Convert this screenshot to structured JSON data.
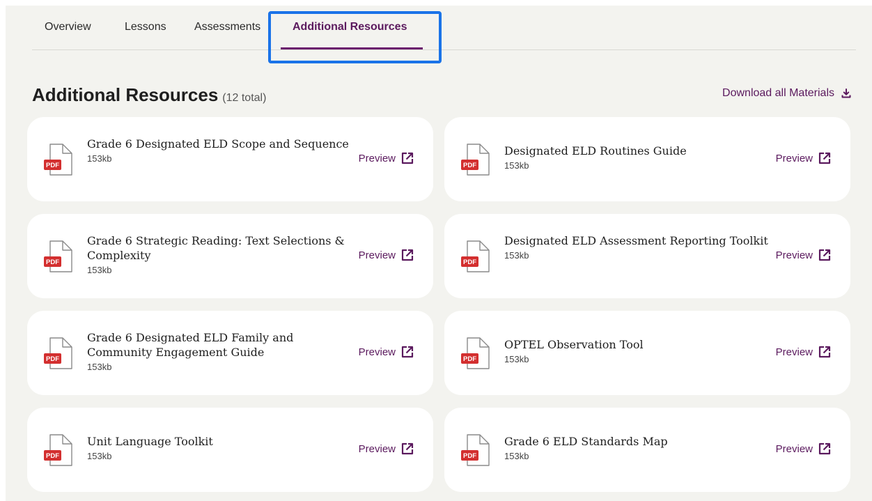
{
  "tabs": [
    {
      "label": "Overview"
    },
    {
      "label": "Lessons"
    },
    {
      "label": "Assessments"
    },
    {
      "label": "Additional Resources"
    }
  ],
  "section": {
    "title": "Additional Resources",
    "count": "(12 total)",
    "download_label": "Download all Materials"
  },
  "resources": [
    {
      "title": "Grade 6 Designated ELD Scope and Sequence",
      "size": "153kb",
      "type": "PDF",
      "preview": "Preview"
    },
    {
      "title": "Designated ELD Routines Guide",
      "size": "153kb",
      "type": "PDF",
      "preview": "Preview"
    },
    {
      "title": "Grade 6 Strategic Reading: Text Selections & Complexity",
      "size": "153kb",
      "type": "PDF",
      "preview": "Preview"
    },
    {
      "title": "Designated ELD Assessment Reporting Toolkit",
      "size": "153kb",
      "type": "PDF",
      "preview": "Preview"
    },
    {
      "title": "Grade 6 Designated ELD Family and Community Engagement Guide",
      "size": "153kb",
      "type": "PDF",
      "preview": "Preview"
    },
    {
      "title": "OPTEL Observation Tool",
      "size": "153kb",
      "type": "PDF",
      "preview": "Preview"
    },
    {
      "title": "Unit Language Toolkit",
      "size": "153kb",
      "type": "PDF",
      "preview": "Preview"
    },
    {
      "title": "Grade 6 ELD Standards Map",
      "size": "153kb",
      "type": "PDF",
      "preview": "Preview"
    }
  ],
  "colors": {
    "accent": "#5b1a5e",
    "pdf_badge": "#d32f2f",
    "highlight": "#1a73e8",
    "background": "#f3f3ef"
  }
}
